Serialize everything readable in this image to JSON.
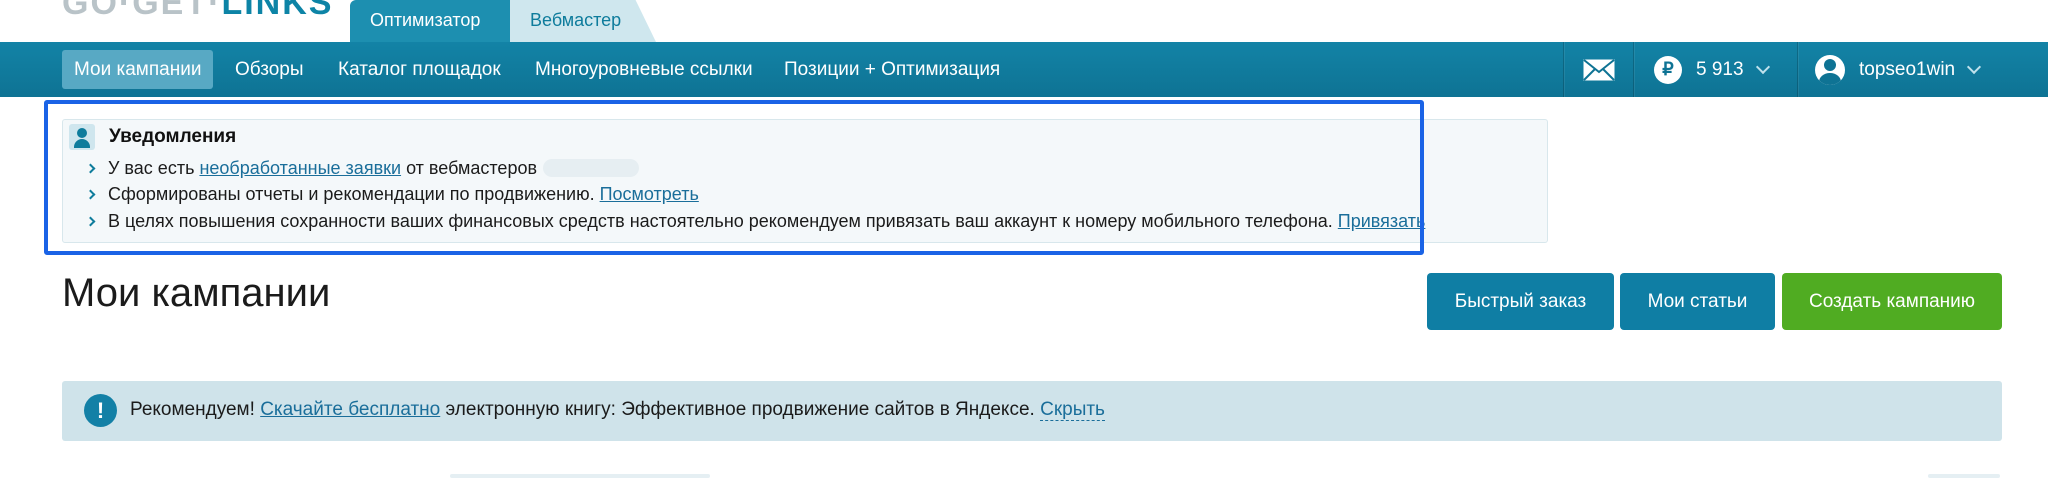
{
  "logo": {
    "part1": "GO·GET·",
    "part2": "LINKS"
  },
  "role_tabs": {
    "optimizer": "Оптимизатор",
    "webmaster": "Вебмастер"
  },
  "nav": {
    "items": [
      {
        "label": "Мои кампании",
        "active": true
      },
      {
        "label": "Обзоры",
        "active": false
      },
      {
        "label": "Каталог площадок",
        "active": false
      },
      {
        "label": "Многоуровневые ссылки",
        "active": false
      },
      {
        "label": "Позиции + Оптимизация",
        "active": false
      }
    ],
    "balance": "5 913",
    "currency_symbol": "₽",
    "username": "topseo1win",
    "mail_icon": "mail-icon",
    "user_icon": "user-icon"
  },
  "notifications": {
    "title": "Уведомления",
    "line1": {
      "prefix": "У вас есть ",
      "link": "необработанные заявки",
      "suffix": " от вебмастеров"
    },
    "line2": {
      "text": "Сформированы отчеты и рекомендации по продвижению. ",
      "link": "Посмотреть"
    },
    "line3": {
      "text": "В целях повышения сохранности ваших финансовых средств настоятельно рекомендуем привязать ваш аккаунт к номеру мобильного телефона. ",
      "link": "Привязать"
    }
  },
  "page": {
    "title": "Мои кампании",
    "buttons": {
      "quick_order": "Быстрый заказ",
      "my_articles": "Мои статьи",
      "create_campaign": "Создать кампанию"
    }
  },
  "recommendation": {
    "icon_text": "!",
    "prefix": "Рекомендуем! ",
    "link": "Скачайте бесплатно",
    "middle": " электронную книгу: Эффективное продвижение сайтов в Яндексе. ",
    "hide": "Скрыть"
  },
  "colors": {
    "nav_bg": "#0e7394",
    "accent_blue": "#0f7ea4",
    "accent_green": "#50ac22",
    "highlight": "#1a63e6"
  }
}
